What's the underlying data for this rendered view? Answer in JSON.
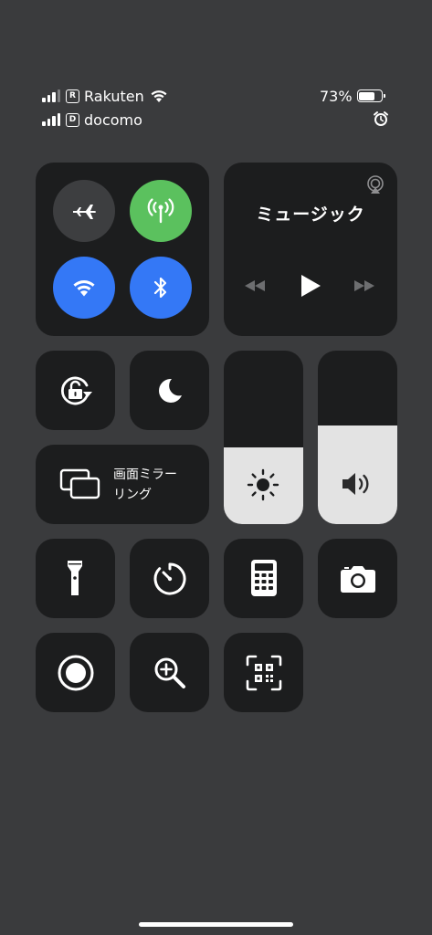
{
  "status_bar": {
    "sim1": {
      "badge": "R",
      "carrier": "Rakuten",
      "bars": 3
    },
    "sim2": {
      "badge": "D",
      "carrier": "docomo",
      "bars": 4
    },
    "battery_percent": "73%",
    "battery_level": 0.73,
    "alarm_icon": "alarm-clock-icon"
  },
  "connectivity": {
    "airplane": {
      "icon": "airplane-icon",
      "on": false
    },
    "cellular": {
      "icon": "cellular-antenna-icon",
      "on": true
    },
    "wifi": {
      "icon": "wifi-icon",
      "on": true
    },
    "bluetooth": {
      "icon": "bluetooth-icon",
      "on": true
    }
  },
  "music": {
    "title": "ミュージック",
    "airplay_icon": "airplay-icon",
    "controls": [
      "rewind-icon",
      "play-icon",
      "fast-forward-icon"
    ]
  },
  "orientation_lock": {
    "icon": "rotation-lock-icon"
  },
  "do_not_disturb": {
    "icon": "moon-icon"
  },
  "screen_mirroring": {
    "label_line1": "画面ミラー",
    "label_line2": "リング",
    "icon": "screen-mirroring-icon"
  },
  "brightness": {
    "icon": "sun-icon",
    "level": 0.44
  },
  "volume": {
    "icon": "speaker-icon",
    "level": 0.57
  },
  "shortcuts": [
    {
      "name": "flashlight",
      "icon": "flashlight-icon"
    },
    {
      "name": "timer",
      "icon": "timer-icon"
    },
    {
      "name": "calculator",
      "icon": "calculator-icon"
    },
    {
      "name": "camera",
      "icon": "camera-icon"
    },
    {
      "name": "screen-recording",
      "icon": "record-icon"
    },
    {
      "name": "magnifier",
      "icon": "magnifier-icon"
    },
    {
      "name": "qr-scanner",
      "icon": "qr-code-icon"
    }
  ],
  "colors": {
    "background": "#3a3b3d",
    "tile": "#1c1d1e",
    "active_green": "#5bc15e",
    "active_blue": "#3478f6",
    "slider_fill": "#e3e3e3"
  }
}
